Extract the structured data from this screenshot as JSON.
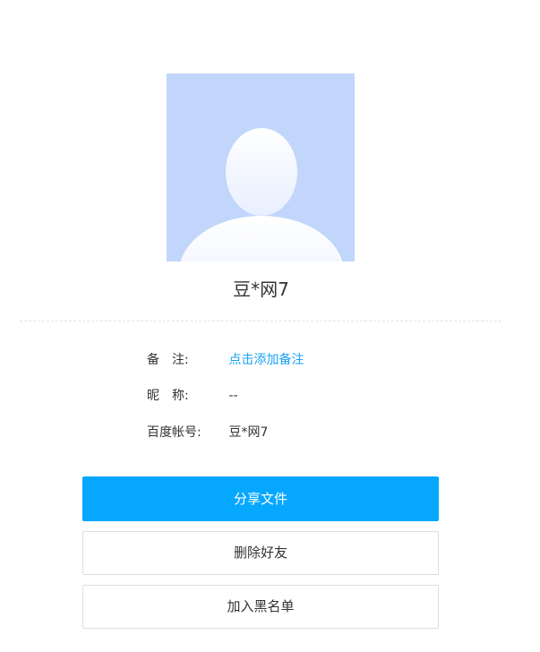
{
  "profile": {
    "username": "豆*网7",
    "avatar_icon": "default-user-avatar-icon",
    "avatar_bg": "#c2d6fb"
  },
  "info": {
    "remark_label": "备　注:",
    "remark_value": "点击添加备注",
    "nickname_label": "昵　称:",
    "nickname_value": "--",
    "account_label": "百度帐号:",
    "account_value": "豆*网7"
  },
  "actions": {
    "share_label": "分享文件",
    "delete_label": "删除好友",
    "block_label": "加入黑名单"
  },
  "colors": {
    "primary": "#06a7ff",
    "link": "#1aa1f7"
  }
}
